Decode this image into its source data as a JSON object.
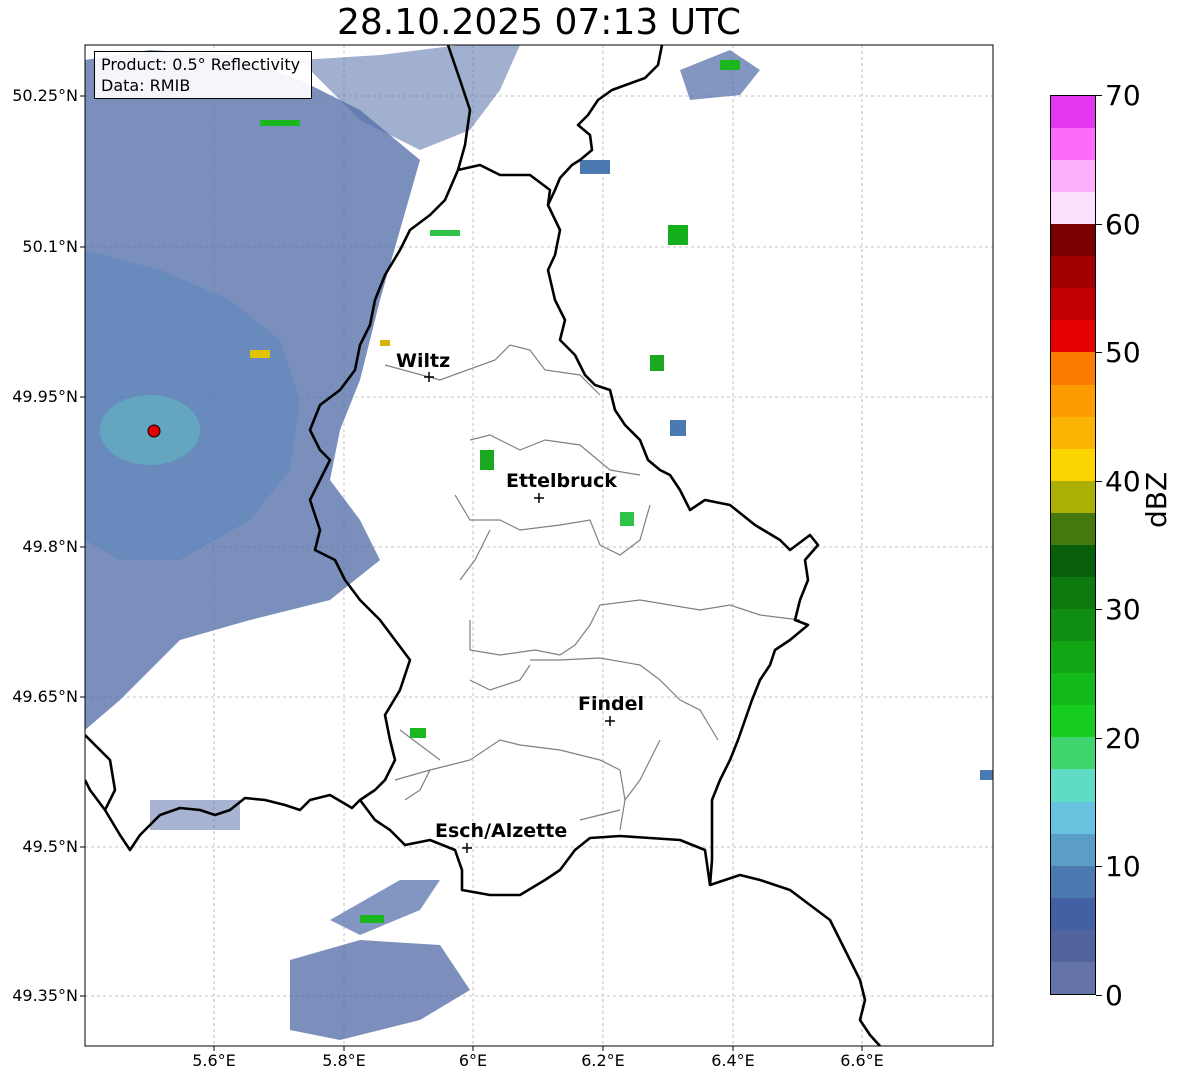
{
  "title": "28.10.2025 07:13 UTC",
  "info_box": {
    "line1": "Product: 0.5° Reflectivity",
    "line2": "Data: RMIB"
  },
  "lat_labels": [
    "50.25°N",
    "50.1°N",
    "49.95°N",
    "49.8°N",
    "49.65°N",
    "49.5°N",
    "49.35°N"
  ],
  "lon_labels": [
    "5.6°E",
    "5.8°E",
    "6°E",
    "6.2°E",
    "6.4°E",
    "6.6°E"
  ],
  "cities": [
    {
      "name": "Wiltz"
    },
    {
      "name": "Ettelbruck"
    },
    {
      "name": "Findel"
    },
    {
      "name": "Esch/Alzette"
    }
  ],
  "colorbar": {
    "unit": "dBZ",
    "tick_labels": [
      "0",
      "10",
      "20",
      "30",
      "40",
      "50",
      "60",
      "70"
    ],
    "colors": [
      "#6474a8",
      "#52649e",
      "#4460a4",
      "#4a7ab0",
      "#5a9ec6",
      "#66c2de",
      "#60dcc4",
      "#3ed46e",
      "#16cc1e",
      "#14ba1c",
      "#12a614",
      "#108e14",
      "#0c7a0e",
      "#08600a",
      "#467810",
      "#acb004",
      "#fcd400",
      "#fcb404",
      "#fc9c00",
      "#fc7c00",
      "#e40000",
      "#c00000",
      "#a00000",
      "#780000",
      "#fde0fe",
      "#fcb0fc",
      "#fc6cfc",
      "#e438f0"
    ]
  },
  "colors": {
    "border": "#000000",
    "canton_border": "#808080",
    "radar_site": "#e00000"
  }
}
